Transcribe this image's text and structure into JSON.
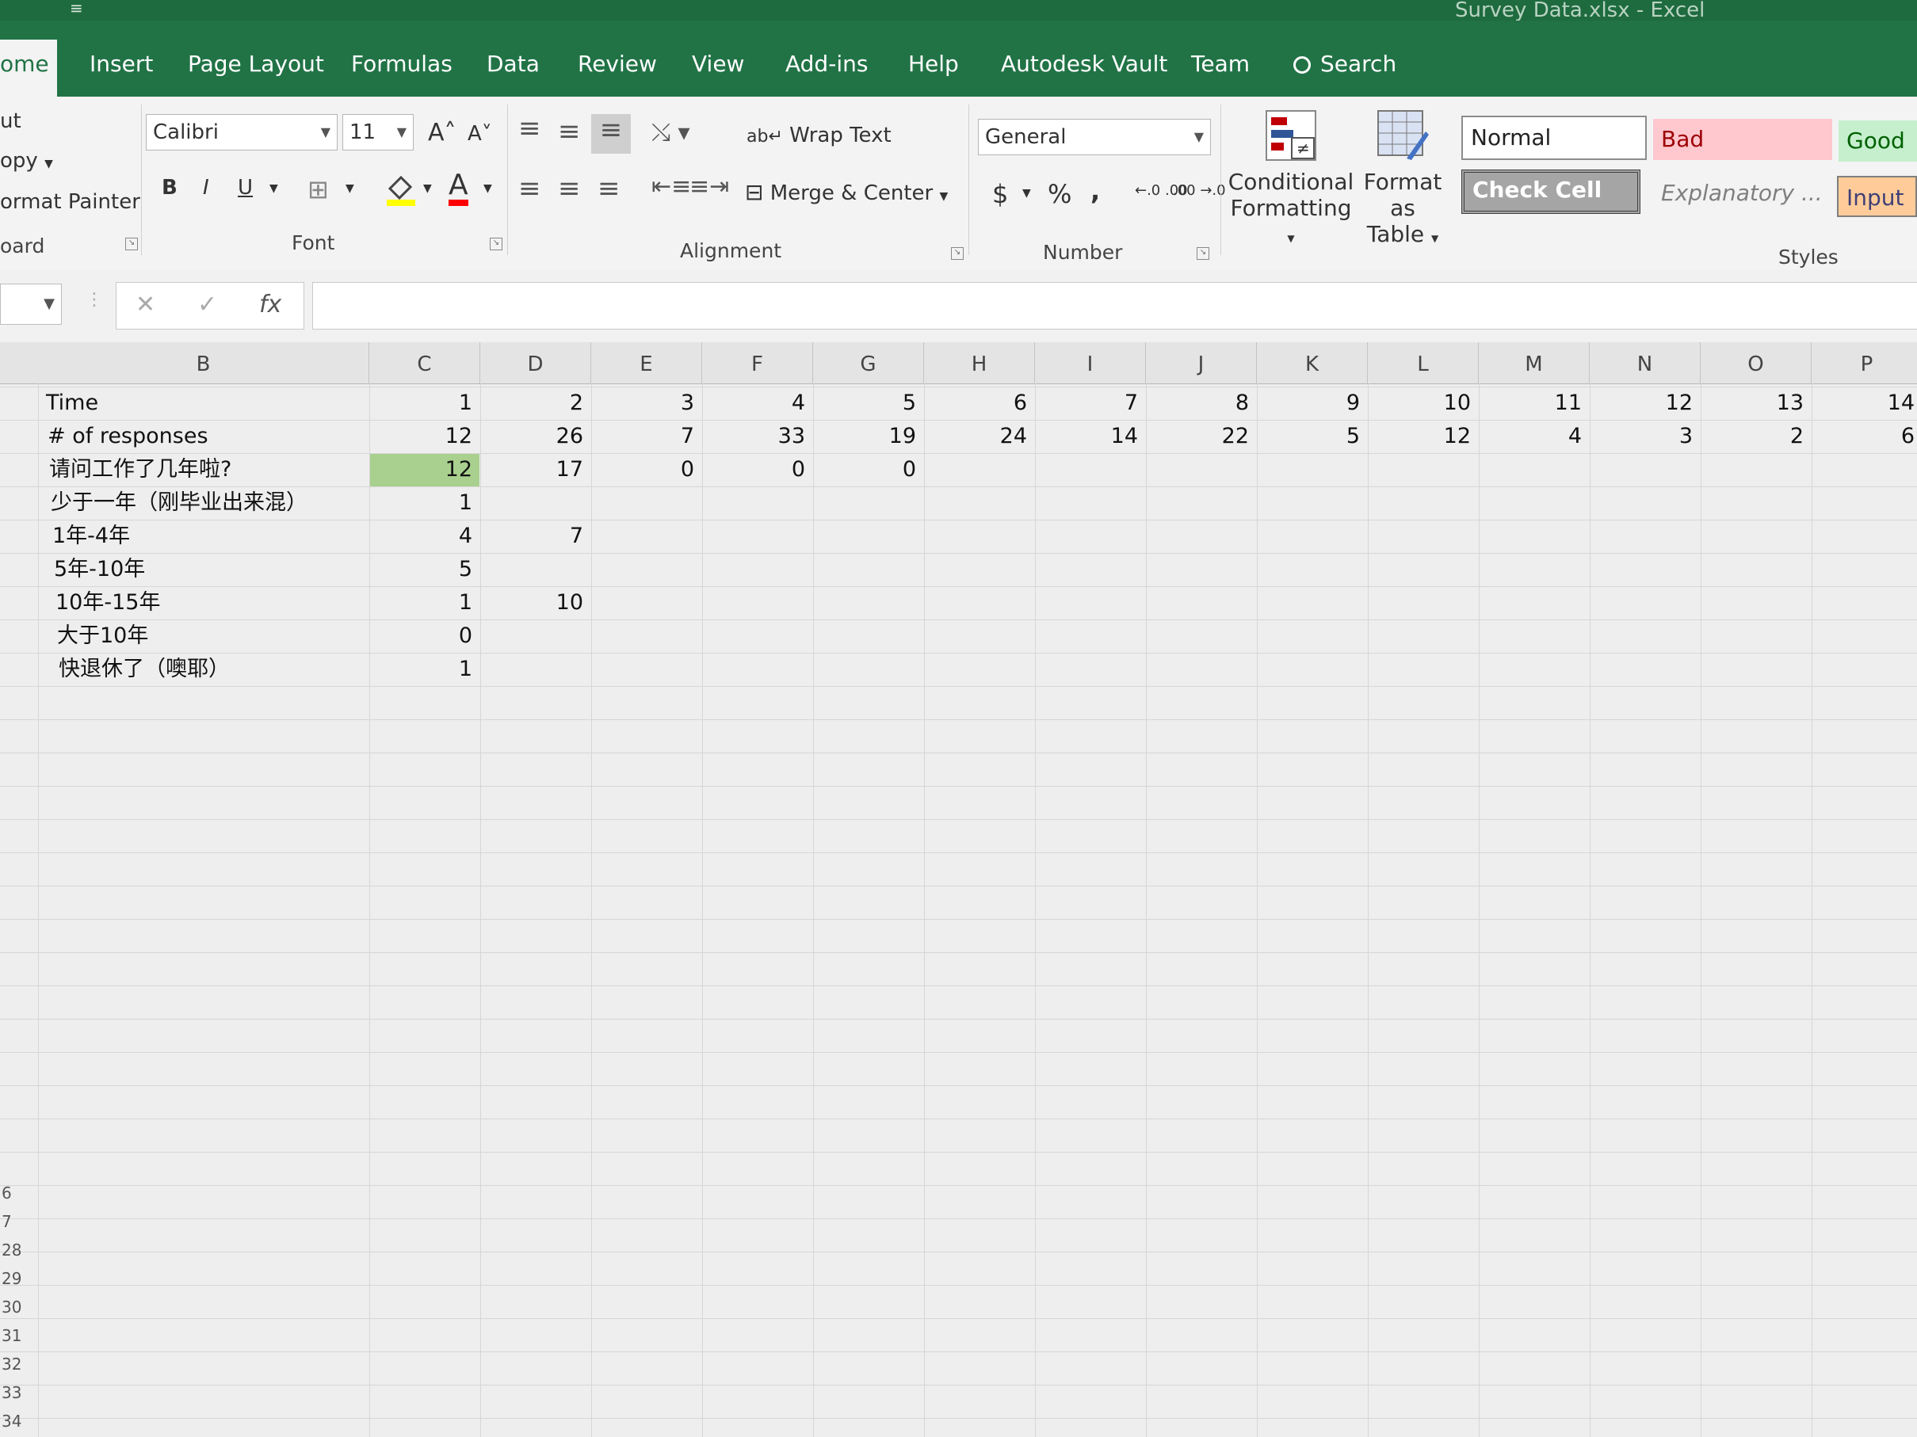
{
  "window": {
    "title": "Survey Data.xlsx  -  Excel",
    "quick_access": "≡"
  },
  "ribbon_tabs": [
    "ome",
    "Insert",
    "Page Layout",
    "Formulas",
    "Data",
    "Review",
    "View",
    "Add-ins",
    "Help",
    "Autodesk Vault",
    "Team"
  ],
  "search_label": "Search",
  "clipboard": {
    "cut": "ut",
    "copy": "opy",
    "format_painter": "ormat Painter",
    "group": "oard"
  },
  "font": {
    "name": "Calibri",
    "size": "11",
    "group": "Font",
    "grow": "A˄",
    "shrink": "A˅",
    "bold": "B",
    "italic": "I",
    "underline": "U",
    "color_letter": "A"
  },
  "alignment": {
    "wrap_text": "Wrap Text",
    "merge_center": "Merge & Center",
    "group": "Alignment"
  },
  "number": {
    "format": "General",
    "currency": "$",
    "percent": "%",
    "comma": ",",
    "group": "Number",
    "inc_dec": "←.0 .00",
    "dec_dec": ".00 →.0"
  },
  "styles": {
    "conditional_formatting": [
      "Conditional",
      "Formatting"
    ],
    "format_as_table": [
      "Format as",
      "Table"
    ],
    "normal": "Normal",
    "bad": "Bad",
    "good": "Good",
    "check_cell": "Check Cell",
    "explanatory": "Explanatory ...",
    "input": "Input",
    "group": "Styles"
  },
  "formula_bar": {
    "cancel": "✕",
    "enter": "✓",
    "fx": "fx",
    "content": ""
  },
  "columns": [
    "B",
    "C",
    "D",
    "E",
    "F",
    "G",
    "H",
    "I",
    "J",
    "K",
    "L",
    "M",
    "N",
    "O",
    "P"
  ],
  "rows": [
    [
      "Time",
      "1",
      "2",
      "3",
      "4",
      "5",
      "6",
      "7",
      "8",
      "9",
      "10",
      "11",
      "12",
      "13",
      "14"
    ],
    [
      "# of responses",
      "12",
      "26",
      "7",
      "33",
      "19",
      "24",
      "14",
      "22",
      "5",
      "12",
      "4",
      "3",
      "2",
      "6"
    ],
    [
      "请问工作了几年啦?",
      "12",
      "17",
      "0",
      "0",
      "0",
      "",
      "",
      "",
      "",
      "",
      "",
      "",
      "",
      ""
    ],
    [
      "少于一年（刚毕业出来混）",
      "1",
      "",
      "",
      "",
      "",
      "",
      "",
      "",
      "",
      "",
      "",
      "",
      "",
      ""
    ],
    [
      "1年-4年",
      "4",
      "7",
      "",
      "",
      "",
      "",
      "",
      "",
      "",
      "",
      "",
      "",
      "",
      ""
    ],
    [
      "5年-10年",
      "5",
      "",
      "",
      "",
      "",
      "",
      "",
      "",
      "",
      "",
      "",
      "",
      "",
      ""
    ],
    [
      "10年-15年",
      "1",
      "10",
      "",
      "",
      "",
      "",
      "",
      "",
      "",
      "",
      "",
      "",
      "",
      ""
    ],
    [
      "大于10年",
      "0",
      "",
      "",
      "",
      "",
      "",
      "",
      "",
      "",
      "",
      "",
      "",
      "",
      ""
    ],
    [
      "快退休了（噢耶）",
      "1",
      "",
      "",
      "",
      "",
      "",
      "",
      "",
      "",
      "",
      "",
      "",
      "",
      ""
    ]
  ],
  "row_numbers": [
    "6",
    "7",
    "28",
    "29",
    "30",
    "31",
    "32",
    "33",
    "34"
  ],
  "colors": {
    "excel_green": "#217346",
    "selected_cell": "#a9d08e",
    "bad_bg": "#ffc7ce",
    "good_bg": "#c6efce",
    "input_bg": "#ffcc99",
    "check_cell_bg": "#a5a5a5"
  }
}
